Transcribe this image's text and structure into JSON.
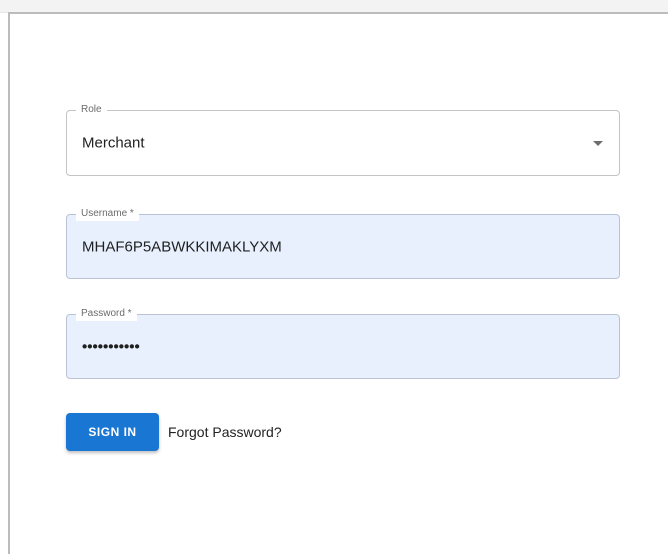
{
  "login_form": {
    "role": {
      "label": "Role",
      "value": "Merchant"
    },
    "username": {
      "label": "Username *",
      "value": "MHAF6P5ABWKKIMAKLYXM"
    },
    "password": {
      "label": "Password *",
      "masked_value": "•••••••••••"
    },
    "sign_in_label": "SIGN IN",
    "forgot_password_label": "Forgot Password?"
  },
  "colors": {
    "primary": "#1976d2",
    "autofill_bg": "#e8f0fe"
  },
  "icons": {
    "role_dropdown": "chevron-down-icon"
  }
}
